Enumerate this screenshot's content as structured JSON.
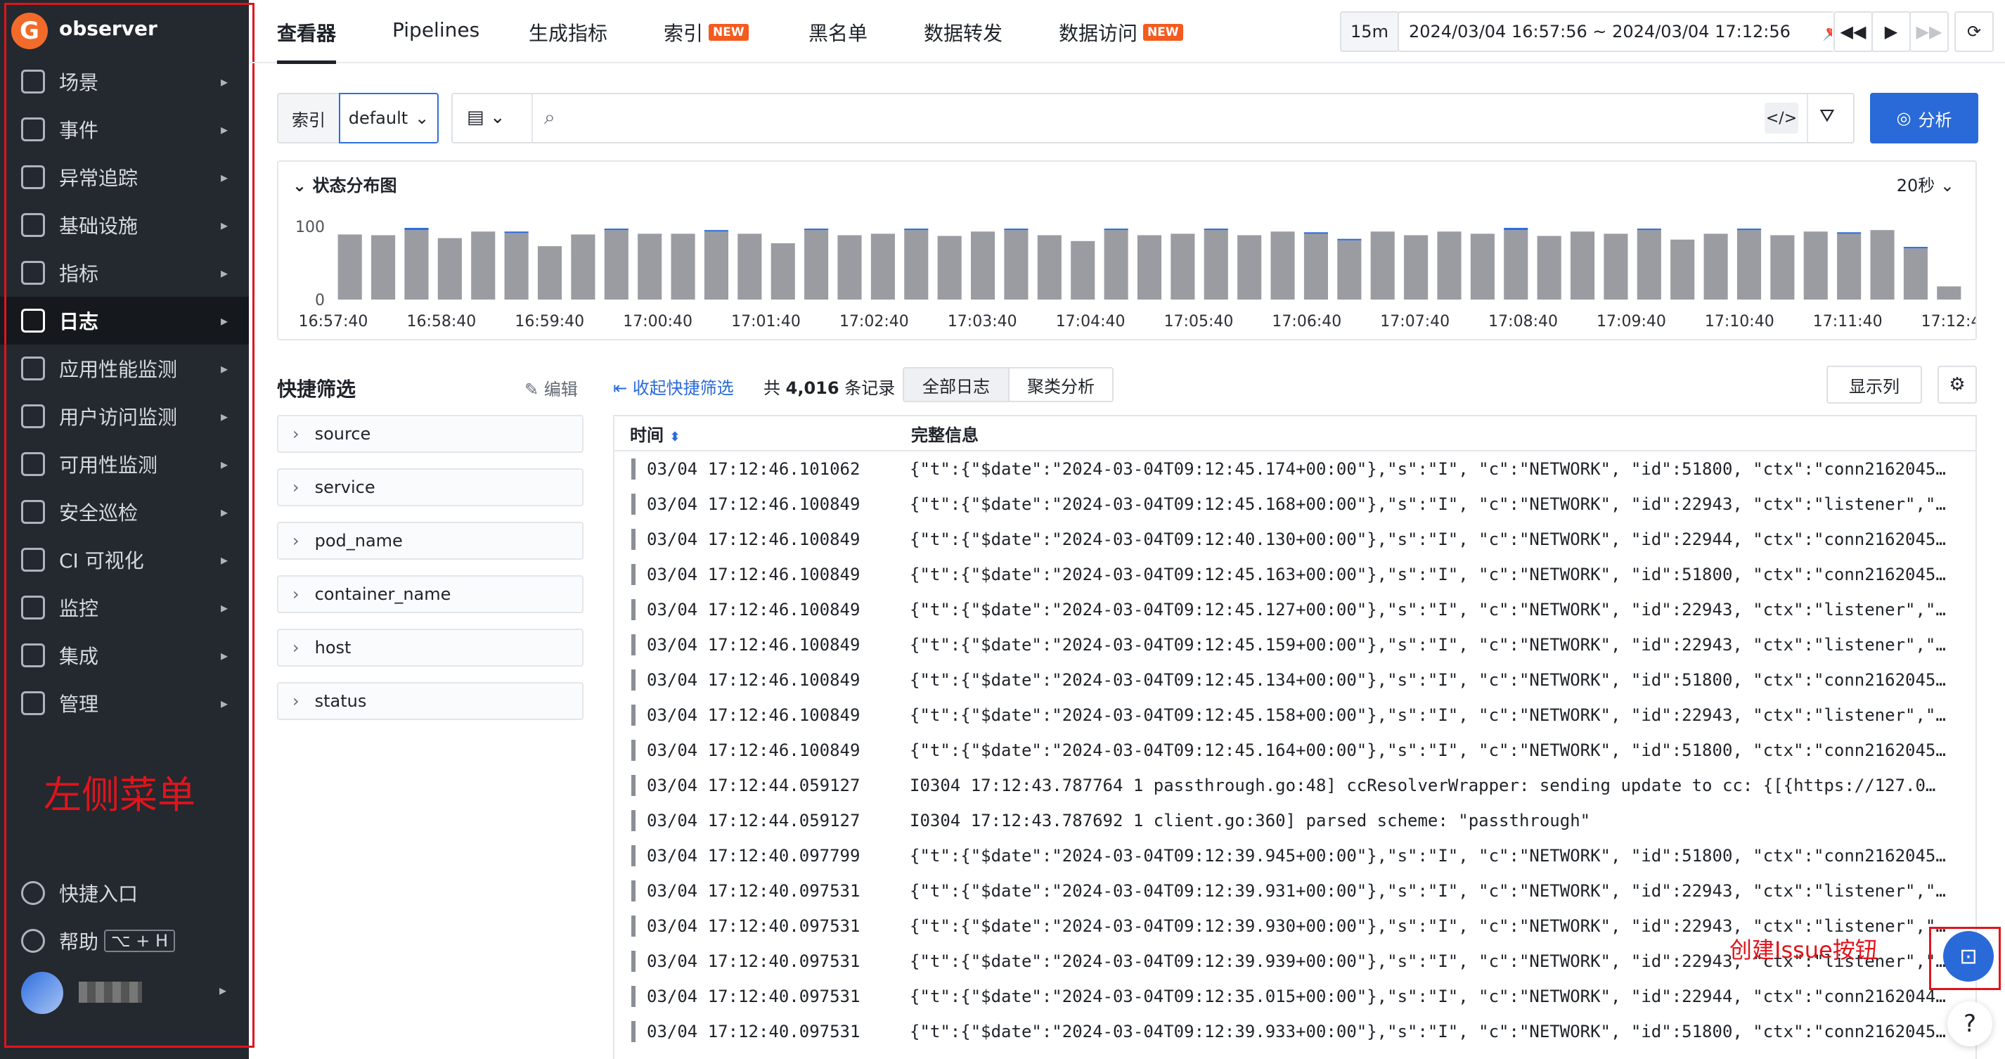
{
  "app_name": "observer",
  "sidebar": {
    "items": [
      {
        "label": "场景",
        "icon": "monitor-icon"
      },
      {
        "label": "事件",
        "icon": "calendar-icon"
      },
      {
        "label": "异常追踪",
        "icon": "target-icon"
      },
      {
        "label": "基础设施",
        "icon": "nodes-icon"
      },
      {
        "label": "指标",
        "icon": "chart-icon"
      },
      {
        "label": "日志",
        "icon": "log-search-icon",
        "active": true
      },
      {
        "label": "应用性能监测",
        "icon": "list-icon"
      },
      {
        "label": "用户访问监测",
        "icon": "grid-icon"
      },
      {
        "label": "可用性监测",
        "icon": "ban-icon"
      },
      {
        "label": "安全巡检",
        "icon": "shield-icon"
      },
      {
        "label": "CI 可视化",
        "icon": "ci-icon"
      },
      {
        "label": "监控",
        "icon": "camera-icon"
      },
      {
        "label": "集成",
        "icon": "cube-icon"
      },
      {
        "label": "管理",
        "icon": "sliders-icon"
      }
    ],
    "quick_entry": "快捷入口",
    "help": "帮助",
    "help_shortcut": "⌥ + H",
    "annotation": "左侧菜单"
  },
  "tabs": [
    "查看器",
    "Pipelines",
    "生成指标",
    "索引",
    "黑名单",
    "数据转发",
    "数据访问"
  ],
  "new_badge": "NEW",
  "time": {
    "preset": "15m",
    "range": "2024/03/04 16:57:56 ~ 2024/03/04 17:12:56"
  },
  "search": {
    "index_label": "索引",
    "index_value": "default",
    "button": "分析"
  },
  "chart_data": {
    "type": "bar",
    "title": "状态分布图",
    "interval": "20秒",
    "ylim": [
      0,
      100
    ],
    "yticks": [
      0,
      100
    ],
    "xticks": [
      "16:57:40",
      "16:58:40",
      "16:59:40",
      "17:00:40",
      "17:01:40",
      "17:02:40",
      "17:03:40",
      "17:04:40",
      "17:05:40",
      "17:06:40",
      "17:07:40",
      "17:08:40",
      "17:09:40",
      "17:10:40",
      "17:11:40",
      "17:12:40"
    ],
    "series": [
      {
        "color": "#9a9ca2",
        "values": [
          89,
          88,
          95,
          84,
          93,
          91,
          73,
          89,
          95,
          90,
          90,
          93,
          90,
          77,
          95,
          88,
          90,
          95,
          87,
          93,
          95,
          88,
          80,
          95,
          88,
          90,
          95,
          88,
          93,
          90,
          81,
          93,
          88,
          93,
          90,
          95,
          87,
          93,
          90,
          95,
          82,
          90,
          95,
          88,
          93,
          90,
          95,
          70,
          18
        ]
      },
      {
        "color": "#2a6ad8",
        "values": [
          0,
          0,
          3,
          0,
          0,
          2,
          0,
          0,
          2,
          0,
          0,
          2,
          0,
          0,
          2,
          0,
          0,
          2,
          0,
          0,
          2,
          0,
          0,
          2,
          0,
          0,
          2,
          0,
          0,
          2,
          2,
          0,
          0,
          0,
          0,
          3,
          0,
          0,
          0,
          2,
          0,
          0,
          2,
          0,
          0,
          2,
          0,
          2,
          0
        ]
      }
    ]
  },
  "quick_filter": {
    "title": "快捷筛选",
    "edit": "编辑",
    "collapse": "收起快捷筛选",
    "facets": [
      "source",
      "service",
      "pod_name",
      "container_name",
      "host",
      "status"
    ]
  },
  "summary": {
    "prefix": "共",
    "count": "4,016",
    "suffix": "条记录"
  },
  "views": {
    "all": "全部日志",
    "cluster": "聚类分析",
    "columns": "显示列"
  },
  "table": {
    "col_time": "时间",
    "col_msg": "完整信息",
    "rows": [
      {
        "time": "03/04 17:12:46.101062",
        "msg": "{\"t\":{\"$date\":\"2024-03-04T09:12:45.174+00:00\"},\"s\":\"I\", \"c\":\"NETWORK\", \"id\":51800, \"ctx\":\"conn2162045…"
      },
      {
        "time": "03/04 17:12:46.100849",
        "msg": "{\"t\":{\"$date\":\"2024-03-04T09:12:45.168+00:00\"},\"s\":\"I\", \"c\":\"NETWORK\", \"id\":22943, \"ctx\":\"listener\",\"…"
      },
      {
        "time": "03/04 17:12:46.100849",
        "msg": "{\"t\":{\"$date\":\"2024-03-04T09:12:40.130+00:00\"},\"s\":\"I\", \"c\":\"NETWORK\", \"id\":22944, \"ctx\":\"conn2162045…"
      },
      {
        "time": "03/04 17:12:46.100849",
        "msg": "{\"t\":{\"$date\":\"2024-03-04T09:12:45.163+00:00\"},\"s\":\"I\", \"c\":\"NETWORK\", \"id\":51800, \"ctx\":\"conn2162045…"
      },
      {
        "time": "03/04 17:12:46.100849",
        "msg": "{\"t\":{\"$date\":\"2024-03-04T09:12:45.127+00:00\"},\"s\":\"I\", \"c\":\"NETWORK\", \"id\":22943, \"ctx\":\"listener\",\"…"
      },
      {
        "time": "03/04 17:12:46.100849",
        "msg": "{\"t\":{\"$date\":\"2024-03-04T09:12:45.159+00:00\"},\"s\":\"I\", \"c\":\"NETWORK\", \"id\":22943, \"ctx\":\"listener\",\"…"
      },
      {
        "time": "03/04 17:12:46.100849",
        "msg": "{\"t\":{\"$date\":\"2024-03-04T09:12:45.134+00:00\"},\"s\":\"I\", \"c\":\"NETWORK\", \"id\":51800, \"ctx\":\"conn2162045…"
      },
      {
        "time": "03/04 17:12:46.100849",
        "msg": "{\"t\":{\"$date\":\"2024-03-04T09:12:45.158+00:00\"},\"s\":\"I\", \"c\":\"NETWORK\", \"id\":22943, \"ctx\":\"listener\",\"…"
      },
      {
        "time": "03/04 17:12:46.100849",
        "msg": "{\"t\":{\"$date\":\"2024-03-04T09:12:45.164+00:00\"},\"s\":\"I\", \"c\":\"NETWORK\", \"id\":51800, \"ctx\":\"conn2162045…"
      },
      {
        "time": "03/04 17:12:44.059127",
        "msg": "I0304 17:12:43.787764 1 passthrough.go:48] ccResolverWrapper: sending update to cc: {[{https://127.0…"
      },
      {
        "time": "03/04 17:12:44.059127",
        "msg": "I0304 17:12:43.787692 1 client.go:360] parsed scheme: \"passthrough\""
      },
      {
        "time": "03/04 17:12:40.097799",
        "msg": "{\"t\":{\"$date\":\"2024-03-04T09:12:39.945+00:00\"},\"s\":\"I\", \"c\":\"NETWORK\", \"id\":51800, \"ctx\":\"conn2162045…"
      },
      {
        "time": "03/04 17:12:40.097531",
        "msg": "{\"t\":{\"$date\":\"2024-03-04T09:12:39.931+00:00\"},\"s\":\"I\", \"c\":\"NETWORK\", \"id\":22943, \"ctx\":\"listener\",\"…"
      },
      {
        "time": "03/04 17:12:40.097531",
        "msg": "{\"t\":{\"$date\":\"2024-03-04T09:12:39.930+00:00\"},\"s\":\"I\", \"c\":\"NETWORK\", \"id\":22943, \"ctx\":\"listener\",\"…"
      },
      {
        "time": "03/04 17:12:40.097531",
        "msg": "{\"t\":{\"$date\":\"2024-03-04T09:12:39.939+00:00\"},\"s\":\"I\", \"c\":\"NETWORK\", \"id\":22943, \"ctx\":\"listener\",\"…"
      },
      {
        "time": "03/04 17:12:40.097531",
        "msg": "{\"t\":{\"$date\":\"2024-03-04T09:12:35.015+00:00\"},\"s\":\"I\", \"c\":\"NETWORK\", \"id\":22944, \"ctx\":\"conn2162044…"
      },
      {
        "time": "03/04 17:12:40.097531",
        "msg": "{\"t\":{\"$date\":\"2024-03-04T09:12:39.933+00:00\"},\"s\":\"I\", \"c\":\"NETWORK\", \"id\":51800, \"ctx\":\"conn2162045…"
      }
    ]
  },
  "issue_annotation": "创建Issue按钮"
}
